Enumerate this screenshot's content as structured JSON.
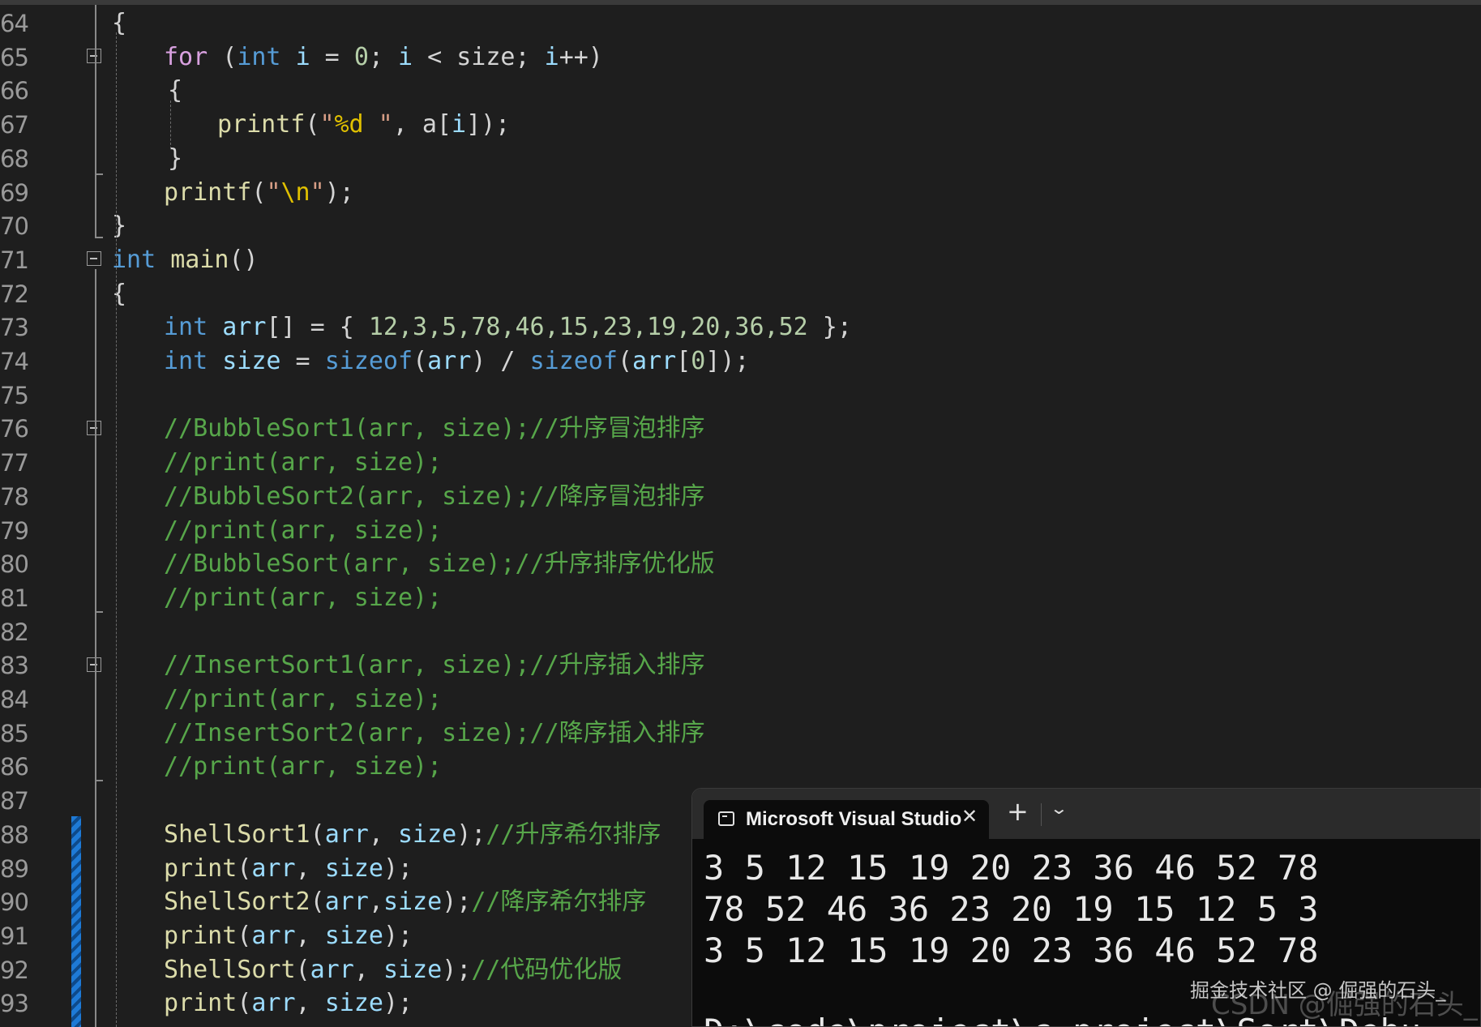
{
  "editor": {
    "lines": [
      {
        "n": "64",
        "t": [
          {
            "c": "p",
            "s": "{"
          }
        ]
      },
      {
        "n": "65",
        "t": [
          {
            "c": "ctl",
            "s": "for"
          },
          {
            "c": "p",
            "s": " ("
          },
          {
            "c": "kw",
            "s": "int"
          },
          {
            "c": "p",
            "s": " "
          },
          {
            "c": "var",
            "s": "i"
          },
          {
            "c": "p",
            "s": " = "
          },
          {
            "c": "num",
            "s": "0"
          },
          {
            "c": "p",
            "s": "; "
          },
          {
            "c": "var",
            "s": "i"
          },
          {
            "c": "p",
            "s": " < size; "
          },
          {
            "c": "var",
            "s": "i"
          },
          {
            "c": "p",
            "s": "++)"
          }
        ]
      },
      {
        "n": "66",
        "t": [
          {
            "c": "p",
            "s": "{"
          }
        ]
      },
      {
        "n": "67",
        "t": [
          {
            "c": "fn",
            "s": "printf"
          },
          {
            "c": "p",
            "s": "("
          },
          {
            "c": "str",
            "s": "\""
          },
          {
            "c": "esc",
            "s": "%d"
          },
          {
            "c": "str",
            "s": " \""
          },
          {
            "c": "p",
            "s": ", a["
          },
          {
            "c": "var",
            "s": "i"
          },
          {
            "c": "p",
            "s": "]);"
          }
        ]
      },
      {
        "n": "68",
        "t": [
          {
            "c": "p",
            "s": "}"
          }
        ]
      },
      {
        "n": "69",
        "t": [
          {
            "c": "fn",
            "s": "printf"
          },
          {
            "c": "p",
            "s": "("
          },
          {
            "c": "str",
            "s": "\""
          },
          {
            "c": "esc",
            "s": "\\n"
          },
          {
            "c": "str",
            "s": "\""
          },
          {
            "c": "p",
            "s": ");"
          }
        ]
      },
      {
        "n": "70",
        "t": [
          {
            "c": "p",
            "s": "}"
          }
        ]
      },
      {
        "n": "71",
        "t": [
          {
            "c": "kw",
            "s": "int"
          },
          {
            "c": "p",
            "s": " "
          },
          {
            "c": "fn",
            "s": "main"
          },
          {
            "c": "p",
            "s": "()"
          }
        ]
      },
      {
        "n": "72",
        "t": [
          {
            "c": "p",
            "s": "{"
          }
        ]
      },
      {
        "n": "73",
        "t": [
          {
            "c": "kw",
            "s": "int"
          },
          {
            "c": "p",
            "s": " "
          },
          {
            "c": "var",
            "s": "arr"
          },
          {
            "c": "p",
            "s": "[] = { "
          },
          {
            "c": "num",
            "s": "12,3,5,78,46,15,23,19,20,36,52"
          },
          {
            "c": "p",
            "s": " };"
          }
        ]
      },
      {
        "n": "74",
        "t": [
          {
            "c": "kw",
            "s": "int"
          },
          {
            "c": "p",
            "s": " "
          },
          {
            "c": "var",
            "s": "size"
          },
          {
            "c": "p",
            "s": " = "
          },
          {
            "c": "kw",
            "s": "sizeof"
          },
          {
            "c": "p",
            "s": "("
          },
          {
            "c": "var",
            "s": "arr"
          },
          {
            "c": "p",
            "s": ") / "
          },
          {
            "c": "kw",
            "s": "sizeof"
          },
          {
            "c": "p",
            "s": "("
          },
          {
            "c": "var",
            "s": "arr"
          },
          {
            "c": "p",
            "s": "["
          },
          {
            "c": "num",
            "s": "0"
          },
          {
            "c": "p",
            "s": "]);"
          }
        ]
      },
      {
        "n": "75",
        "t": []
      },
      {
        "n": "76",
        "t": [
          {
            "c": "cm",
            "s": "//BubbleSort1(arr, size);//升序冒泡排序"
          }
        ]
      },
      {
        "n": "77",
        "t": [
          {
            "c": "cm",
            "s": "//print(arr, size);"
          }
        ]
      },
      {
        "n": "78",
        "t": [
          {
            "c": "cm",
            "s": "//BubbleSort2(arr, size);//降序冒泡排序"
          }
        ]
      },
      {
        "n": "79",
        "t": [
          {
            "c": "cm",
            "s": "//print(arr, size);"
          }
        ]
      },
      {
        "n": "80",
        "t": [
          {
            "c": "cm",
            "s": "//BubbleSort(arr, size);//升序排序优化版"
          }
        ]
      },
      {
        "n": "81",
        "t": [
          {
            "c": "cm",
            "s": "//print(arr, size);"
          }
        ]
      },
      {
        "n": "82",
        "t": []
      },
      {
        "n": "83",
        "t": [
          {
            "c": "cm",
            "s": "//InsertSort1(arr, size);//升序插入排序"
          }
        ]
      },
      {
        "n": "84",
        "t": [
          {
            "c": "cm",
            "s": "//print(arr, size);"
          }
        ]
      },
      {
        "n": "85",
        "t": [
          {
            "c": "cm",
            "s": "//InsertSort2(arr, size);//降序插入排序"
          }
        ]
      },
      {
        "n": "86",
        "t": [
          {
            "c": "cm",
            "s": "//print(arr, size);"
          }
        ]
      },
      {
        "n": "87",
        "t": []
      },
      {
        "n": "88",
        "t": [
          {
            "c": "fn",
            "s": "ShellSort1"
          },
          {
            "c": "p",
            "s": "("
          },
          {
            "c": "var",
            "s": "arr"
          },
          {
            "c": "p",
            "s": ", "
          },
          {
            "c": "var",
            "s": "size"
          },
          {
            "c": "p",
            "s": ");"
          },
          {
            "c": "cm",
            "s": "//升序希尔排序"
          }
        ]
      },
      {
        "n": "89",
        "t": [
          {
            "c": "fn",
            "s": "print"
          },
          {
            "c": "p",
            "s": "("
          },
          {
            "c": "var",
            "s": "arr"
          },
          {
            "c": "p",
            "s": ", "
          },
          {
            "c": "var",
            "s": "size"
          },
          {
            "c": "p",
            "s": ");"
          }
        ]
      },
      {
        "n": "90",
        "t": [
          {
            "c": "fn",
            "s": "ShellSort2"
          },
          {
            "c": "p",
            "s": "("
          },
          {
            "c": "var",
            "s": "arr"
          },
          {
            "c": "p",
            "s": ","
          },
          {
            "c": "var",
            "s": "size"
          },
          {
            "c": "p",
            "s": ");"
          },
          {
            "c": "cm",
            "s": "//降序希尔排序"
          }
        ]
      },
      {
        "n": "91",
        "t": [
          {
            "c": "fn",
            "s": "print"
          },
          {
            "c": "p",
            "s": "("
          },
          {
            "c": "var",
            "s": "arr"
          },
          {
            "c": "p",
            "s": ", "
          },
          {
            "c": "var",
            "s": "size"
          },
          {
            "c": "p",
            "s": ");"
          }
        ]
      },
      {
        "n": "92",
        "t": [
          {
            "c": "fn",
            "s": "ShellSort"
          },
          {
            "c": "p",
            "s": "("
          },
          {
            "c": "var",
            "s": "arr"
          },
          {
            "c": "p",
            "s": ", "
          },
          {
            "c": "var",
            "s": "size"
          },
          {
            "c": "p",
            "s": ");"
          },
          {
            "c": "cm",
            "s": "//代码优化版"
          }
        ]
      },
      {
        "n": "93",
        "t": [
          {
            "c": "fn",
            "s": "print"
          },
          {
            "c": "p",
            "s": "("
          },
          {
            "c": "var",
            "s": "arr"
          },
          {
            "c": "p",
            "s": ", "
          },
          {
            "c": "var",
            "s": "size"
          },
          {
            "c": "p",
            "s": ");"
          }
        ]
      }
    ]
  },
  "terminal": {
    "tab_title": "Microsoft Visual Studio",
    "tab_icon": "terminal-icon",
    "close_glyph": "✕",
    "new_tab_glyph": "+",
    "dropdown_glyph": "⌄",
    "output": [
      "3 5 12 15 19 20 23 36 46 52 78",
      "78 52 46 36 23 20 19 15 12 5 3",
      "3 5 12 15 19 20 23 36 46 52 78"
    ],
    "partial_line": "D:\\code\\project\\c_project\\Sort\\Debu"
  },
  "watermark": {
    "text": "掘金技术社区 @ 倔强的石头_",
    "text2": "CSDN @倔强的石头_"
  }
}
